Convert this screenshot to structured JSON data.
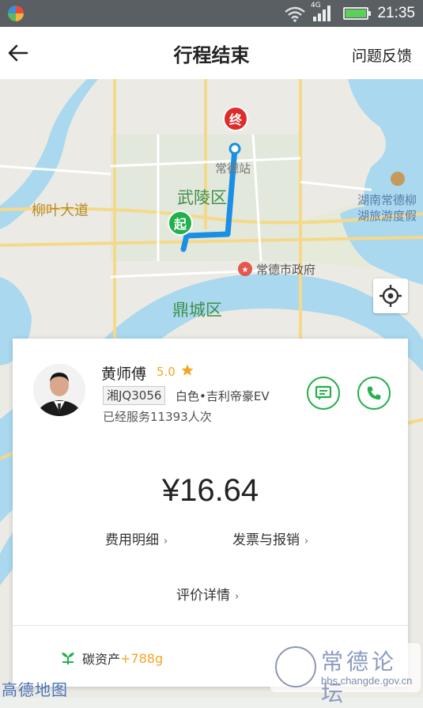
{
  "status_bar": {
    "time": "21:35",
    "network": "4G"
  },
  "header": {
    "title": "行程结束",
    "feedback_label": "问题反馈"
  },
  "map": {
    "labels": {
      "liuye_road": "柳叶大道",
      "wuling_district": "武陵区",
      "dingcheng_district": "鼎城区",
      "station": "常德站",
      "gov": "常德市政府",
      "lake_line1": "湖南常德柳",
      "lake_line2": "湖旅游度假"
    },
    "pins": {
      "start": "起",
      "end": "终"
    },
    "colors": {
      "route": "#1a8fe3",
      "water": "#a9d8ef",
      "green_area": "#cfe8c6"
    }
  },
  "driver": {
    "name": "黄师傅",
    "rating": "5.0",
    "plate": "湘JQ3056",
    "car": "白色•吉利帝豪EV",
    "served": "已经服务11393人次"
  },
  "fare": {
    "price": "¥16.64",
    "fee_detail": "费用明细",
    "invoice": "发票与报销",
    "review": "评价详情"
  },
  "carbon": {
    "label": "碳资产",
    "value": "+788g"
  },
  "map_provider": "高德地图",
  "watermark": {
    "title": "常德论坛",
    "url": "bbs.changde.gov.cn"
  },
  "accent_color": "#22b04b"
}
